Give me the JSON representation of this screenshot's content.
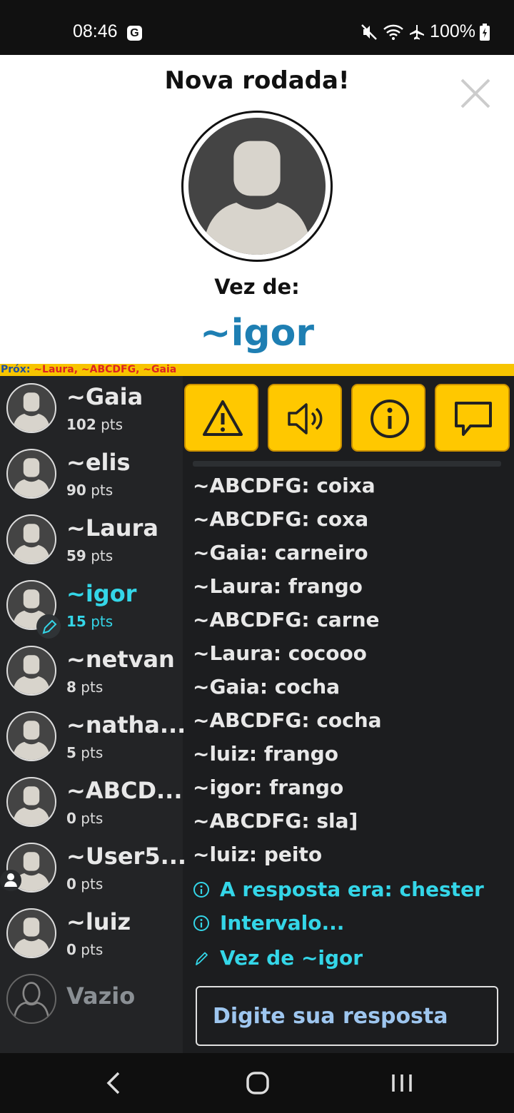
{
  "status": {
    "time": "08:46",
    "badge": "G",
    "battery": "100%"
  },
  "round": {
    "title": "Nova rodada!",
    "turn_label": "Vez de:",
    "turn_player": "~igor"
  },
  "next": {
    "label": "Próx:",
    "players": "~Laura, ~ABCDFG, ~Gaia"
  },
  "players": [
    {
      "name": "~Gaia",
      "score": "102",
      "unit": "pts"
    },
    {
      "name": "~elis",
      "score": "90",
      "unit": "pts"
    },
    {
      "name": "~Laura",
      "score": "59",
      "unit": "pts"
    },
    {
      "name": "~igor",
      "score": "15",
      "unit": "pts"
    },
    {
      "name": "~netvan",
      "score": "8",
      "unit": "pts"
    },
    {
      "name": "~natha...",
      "score": "5",
      "unit": "pts"
    },
    {
      "name": "~ABCD...",
      "score": "0",
      "unit": "pts"
    },
    {
      "name": "~User5...",
      "score": "0",
      "unit": "pts"
    },
    {
      "name": "~luiz",
      "score": "0",
      "unit": "pts"
    }
  ],
  "empty_slot": "Vazio",
  "toolbar": [
    "warning-icon",
    "speaker-icon",
    "info-icon",
    "chat-icon"
  ],
  "chat": [
    "~ABCDFG: coixa",
    "~ABCDFG: coxa",
    "~Gaia: carneiro",
    "~Laura: frango",
    "~ABCDFG: carne",
    "~Laura: cocooo",
    "~Gaia: cocha",
    "~ABCDFG: cocha",
    "~luiz: frango",
    "~igor: frango",
    "~ABCDFG: sla]",
    "~luiz: peito"
  ],
  "system_messages": [
    {
      "icon": "info-icon",
      "text": "A resposta era: chester"
    },
    {
      "icon": "info-icon",
      "text": "Intervalo..."
    },
    {
      "icon": "pencil-icon",
      "text": "Vez de ~igor"
    }
  ],
  "input": {
    "placeholder": "Digite sua resposta"
  },
  "colors": {
    "accent": "#34d6e8",
    "turn": "#1e7fb3",
    "button": "#ffc800",
    "next_bar": "#f7c400"
  }
}
